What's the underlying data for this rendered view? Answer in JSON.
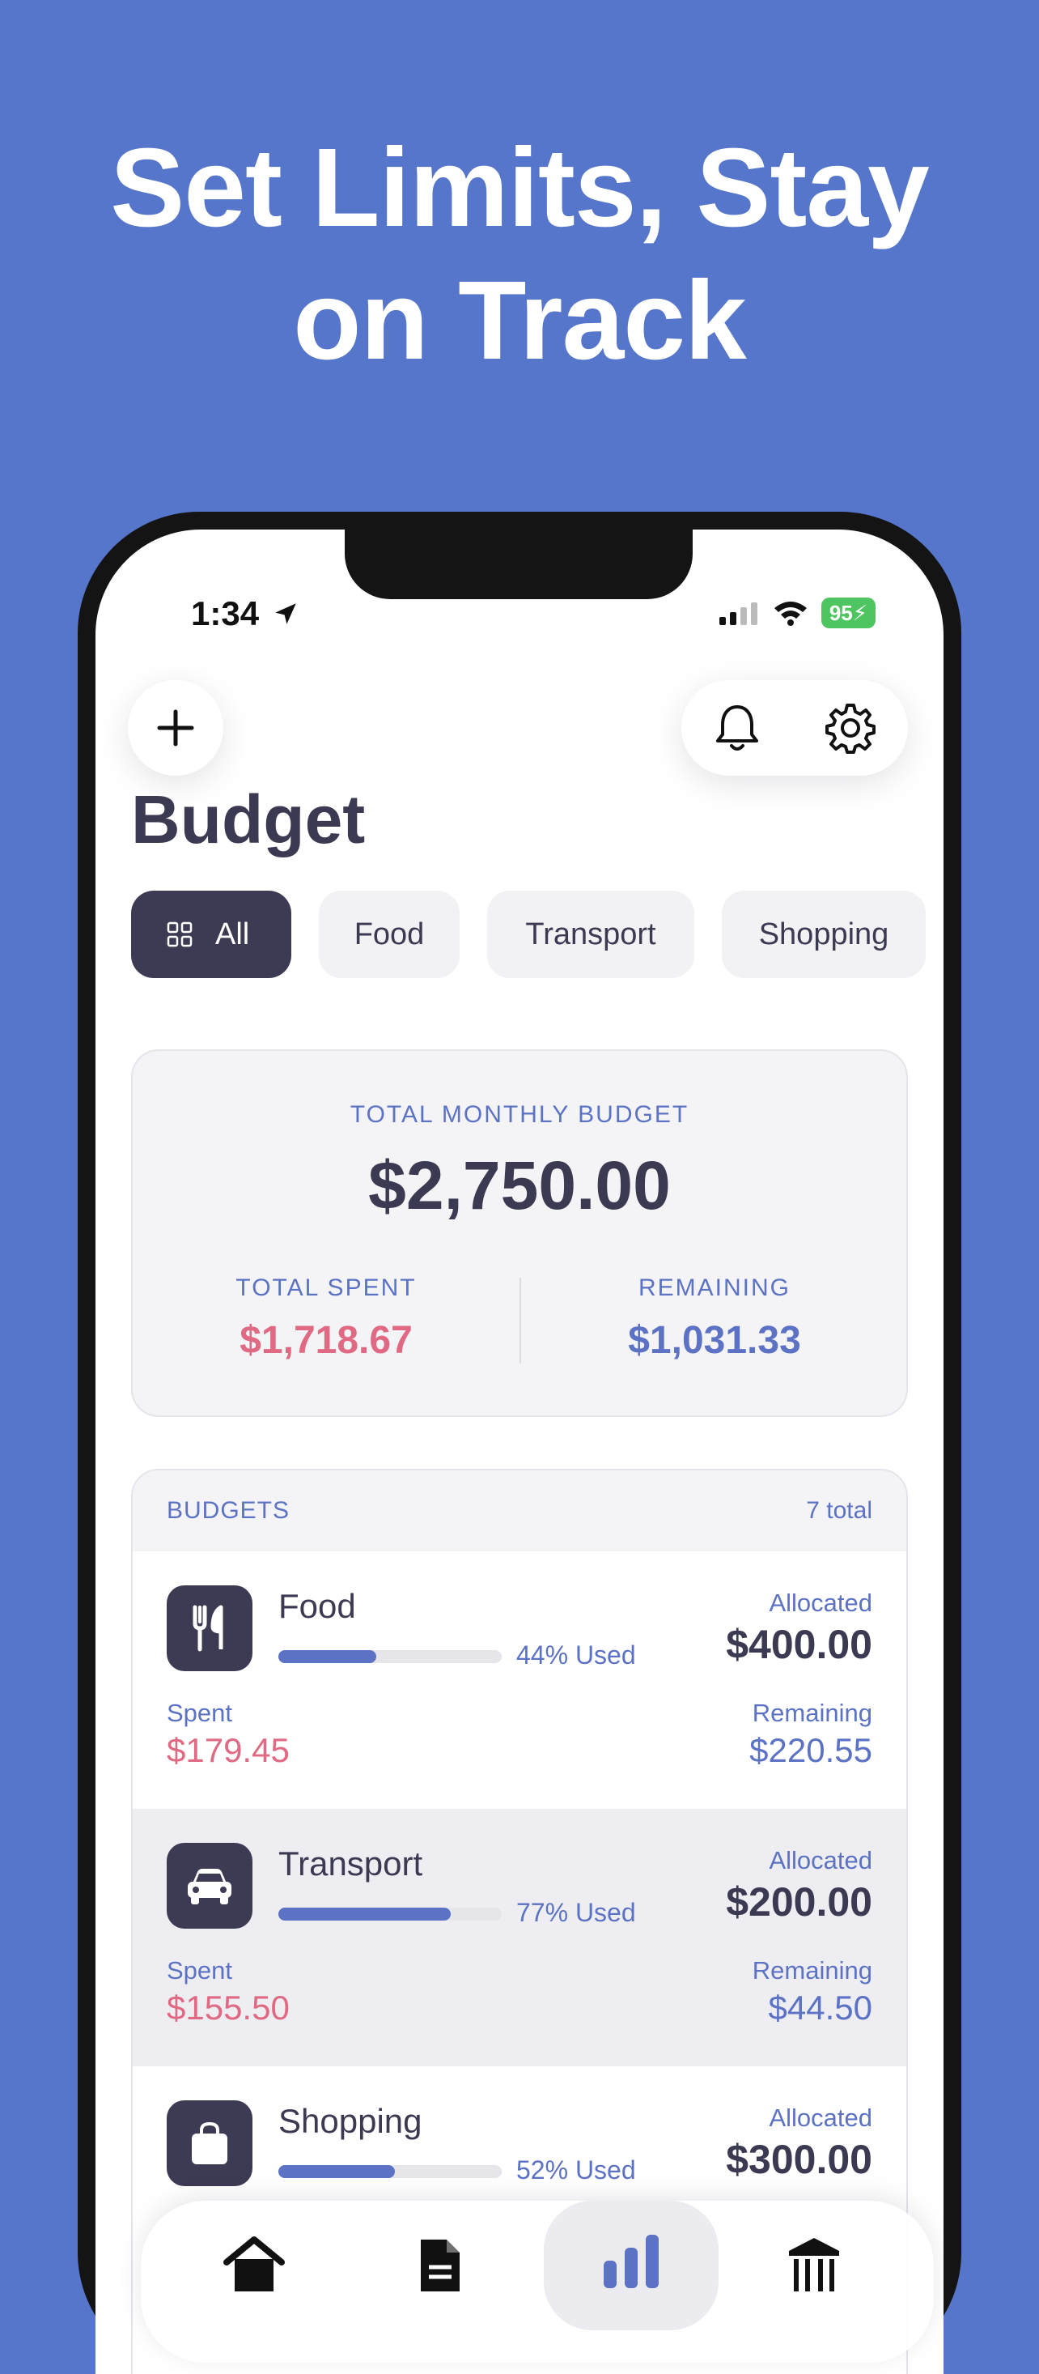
{
  "headline": {
    "line1": "Set Limits, Stay",
    "line2": "on Track"
  },
  "status": {
    "time": "1:34",
    "battery": "95"
  },
  "page": {
    "title": "Budget"
  },
  "chips": [
    "All",
    "Food",
    "Transport",
    "Shopping"
  ],
  "summary": {
    "total_label": "TOTAL MONTHLY BUDGET",
    "total_value": "$2,750.00",
    "spent_label": "TOTAL SPENT",
    "spent_value": "$1,718.67",
    "remaining_label": "REMAINING",
    "remaining_value": "$1,031.33"
  },
  "budgets": {
    "header": "BUDGETS",
    "count": "7 total",
    "items": [
      {
        "name": "Food",
        "icon": "fork-knife-icon",
        "used_pct": 44,
        "used_label": "44% Used",
        "allocated_label": "Allocated",
        "allocated": "$400.00",
        "spent_label": "Spent",
        "spent": "$179.45",
        "remaining_label": "Remaining",
        "remaining": "$220.55"
      },
      {
        "name": "Transport",
        "icon": "car-icon",
        "used_pct": 77,
        "used_label": "77% Used",
        "allocated_label": "Allocated",
        "allocated": "$200.00",
        "spent_label": "Spent",
        "spent": "$155.50",
        "remaining_label": "Remaining",
        "remaining": "$44.50"
      },
      {
        "name": "Shopping",
        "icon": "shopping-bag-icon",
        "used_pct": 52,
        "used_label": "52% Used",
        "allocated_label": "Allocated",
        "allocated": "$300.00"
      }
    ]
  },
  "colors": {
    "background": "#5676cc",
    "accent": "#5c72c4",
    "spent": "#e06a84",
    "dark": "#3d3b54"
  }
}
